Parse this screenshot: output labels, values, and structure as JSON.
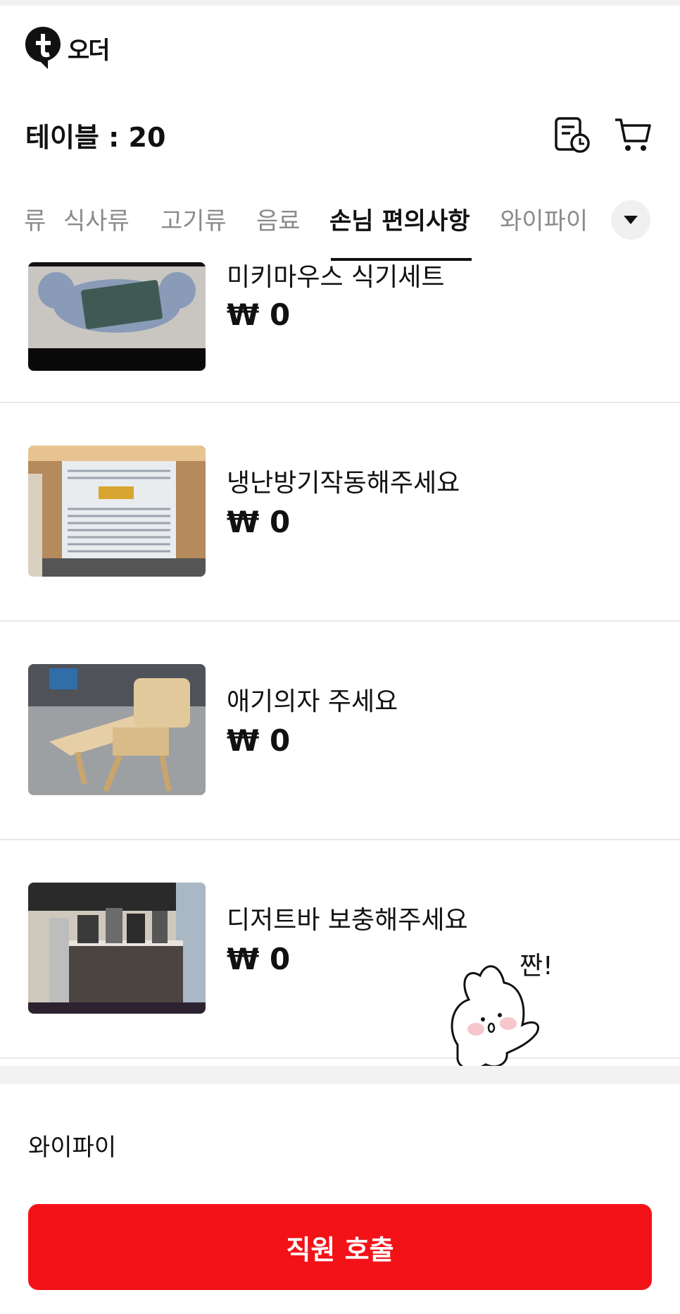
{
  "logo": {
    "text": "오더"
  },
  "header": {
    "table_label": "테이블 : 20"
  },
  "tabs": [
    {
      "label": "류"
    },
    {
      "label": "식사류"
    },
    {
      "label": "고기류"
    },
    {
      "label": "음료"
    },
    {
      "label": "손님 편의사항",
      "active": true
    },
    {
      "label": "와이파이"
    }
  ],
  "items": [
    {
      "name": "미키마우스 식기세트",
      "price": "₩ 0"
    },
    {
      "name": "냉난방기작동해주세요",
      "price": "₩ 0"
    },
    {
      "name": "애기의자 주세요",
      "price": "₩ 0"
    },
    {
      "name": "디저트바 보충해주세요",
      "price": "₩ 0"
    }
  ],
  "sticker": {
    "text": "짠!"
  },
  "footer": {
    "section_label": "와이파이",
    "call_button": "직원 호출"
  },
  "colors": {
    "accent": "#f31218",
    "text": "#111111",
    "muted": "#8a8a8a"
  }
}
